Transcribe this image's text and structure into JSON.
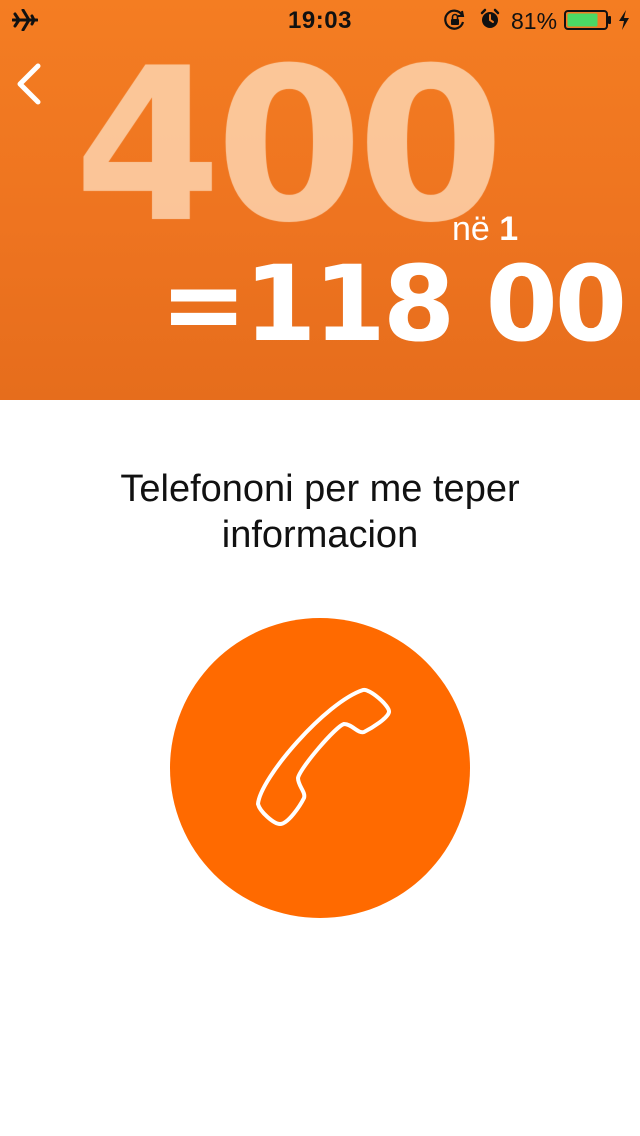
{
  "status_bar": {
    "time": "19:03",
    "battery_percent": "81%",
    "battery_level": 0.81,
    "icons": [
      "airplane-icon",
      "rotation-lock-icon",
      "alarm-icon",
      "battery-icon",
      "charging-icon"
    ]
  },
  "navigation": {
    "back_icon": "chevron-left-icon"
  },
  "promo": {
    "big_number": "400",
    "suffix_text": "në",
    "suffix_number": "1",
    "call_number": "=118 00"
  },
  "content": {
    "info_text": "Telefononi per me teper informacion",
    "call_icon": "phone-icon"
  },
  "colors": {
    "banner": "#f07a21",
    "accent": "#ff6a00",
    "battery_fill": "#4cd964",
    "text": "#111111"
  }
}
